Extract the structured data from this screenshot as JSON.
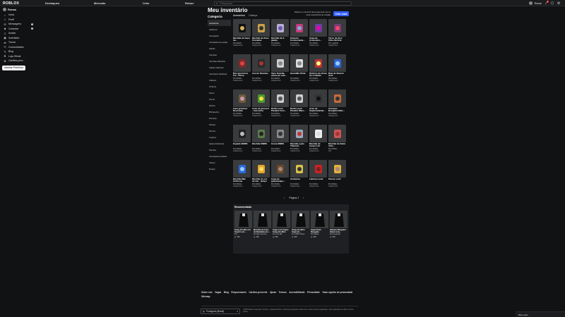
{
  "header": {
    "logo": "ROBLOX",
    "nav": [
      "Destaques",
      "Mercado",
      "Criar",
      "Robux"
    ],
    "search_placeholder": "Pesquisar",
    "username": "Renan",
    "notif_count": "6"
  },
  "sidebar": {
    "user": "Renan",
    "items": [
      {
        "label": "Início",
        "icon": "home-icon"
      },
      {
        "label": "Perfil",
        "icon": "user-icon"
      },
      {
        "label": "Mensagens",
        "icon": "mail-icon",
        "badge": "5"
      },
      {
        "label": "Conectar",
        "icon": "people-icon",
        "badge": "3"
      },
      {
        "label": "Avatar",
        "icon": "avatar-icon"
      },
      {
        "label": "Inventário",
        "icon": "backpack-icon"
      },
      {
        "label": "Trocar",
        "icon": "trade-icon"
      },
      {
        "label": "Comunidades",
        "icon": "group-icon"
      },
      {
        "label": "Blog",
        "icon": "blog-icon"
      },
      {
        "label": "Loja Oficial",
        "icon": "store-icon"
      },
      {
        "label": "Cartões-pres...",
        "icon": "gift-icon"
      }
    ],
    "premium_button": "Assinar Premium"
  },
  "main": {
    "title": "Meu inventário",
    "category_title": "Categoria",
    "tabs": [
      "Acessórios",
      "Cabeça"
    ],
    "hint": "Explore e encontre itens para criar com a nova experiência de criação",
    "create_button": "Criar mais",
    "categories": [
      "Acessórios",
      "Abdômen",
      "Animações",
      "Animações de avatar",
      "Calças",
      "Camisas",
      "Camisas clássicas",
      "Calças clássicas",
      "Camisetas clássicas",
      "Cabelos",
      "Ombros",
      "Faces",
      "Frente",
      "Ofícios",
      "Brinquedos",
      "Pescoço",
      "Passes",
      "Pernas",
      "Lugares",
      "Ações dinâmicas",
      "Pacotes",
      "Animações privadas",
      "Vídeos",
      "Rostos"
    ],
    "items": [
      {
        "name": "Mochila de Caça de...",
        "creator": "Por Roblox",
        "status": "Indisponível"
      },
      {
        "name": "Mochila de Artes Cruzadas",
        "creator": "Por Roblox",
        "status": "Indisponível"
      },
      {
        "name": "Mochila de A jatada",
        "creator": "Por Roblox",
        "status": "Indisponível"
      },
      {
        "name": "Pulseira Cosmonauta...",
        "creator": "Por Roblox",
        "status": "Indisponível"
      },
      {
        "name": "Capa de Assassino...",
        "creator": "Por Roblox",
        "status": "Indisponível"
      },
      {
        "name": "Terno de Alce Ultra-Vertical",
        "creator": "Por Logitech",
        "status": "Indisponível"
      },
      {
        "name": "Nós guerreiros Fur - Pinca",
        "creator": "Por Roblox",
        "status": "Indisponível"
      },
      {
        "name": "Asa do Dracula...",
        "creator": "Por Roblox",
        "status": "Indisponível"
      },
      {
        "name": "Vaso Guarda-chuva de outi...",
        "creator": "Por Roblox",
        "status": "Indisponível"
      },
      {
        "name": "Guardião Prata",
        "creator": "Por Roblox",
        "status": "Indisponível"
      },
      {
        "name": "Ombros de drone de combate",
        "creator": "Por Roblox",
        "status": "Indisponível"
      },
      {
        "name": "Raio de Nuvem Azul",
        "creator": "Por Roblox",
        "status": "Indisponível"
      },
      {
        "name": "Faca grizzinal. Decorada",
        "creator": "Por Roblox",
        "status": "Indisponível"
      },
      {
        "name": "Asas de girassol - Acessório",
        "creator": "Por Roblox",
        "status": "Indisponível"
      },
      {
        "name": "Darth Loom Paradot Fore...",
        "creator": "Por Roblox",
        "status": "Indisponível"
      },
      {
        "name": "Darth Loom Paradot Wars...",
        "creator": "Por Roblox",
        "status": "Indisponível"
      },
      {
        "name": "Asas de Supermaterial...",
        "creator": "Por Roblox",
        "status": "Indisponível"
      },
      {
        "name": "Crianças Bonginia Relic...",
        "creator": "Por Roblox",
        "status": "Indisponível"
      },
      {
        "name": "Espada SINPE",
        "creator": "Por Roblox",
        "status": "Indisponível"
      },
      {
        "name": "Mochila SINPE",
        "creator": "Por Roblox",
        "status": "Indisponível"
      },
      {
        "name": "Cerca SINPE",
        "creator": "Por Roblox",
        "status": "Indisponível"
      },
      {
        "name": "Mochila a jato Titanium",
        "creator": "Por Roblox",
        "status": "Indisponível"
      },
      {
        "name": "Mochila de boneco de neve...",
        "creator": "Por Roblox",
        "status": "Indisponível"
      },
      {
        "name": "Mochila de Salve Vent...",
        "creator": "Por Roblox",
        "status": "100"
      },
      {
        "name": "Mochila Mãe Uniforme",
        "creator": "Por Roblox",
        "status": "Indisponível"
      },
      {
        "name": "Mochila do sol de Hui - tempo",
        "creator": "Por Roblox",
        "status": "Indisponível"
      },
      {
        "name": "Capa de guardanapo...",
        "creator": "Por Roblox",
        "status": "Indisponível"
      },
      {
        "name": "Ambições",
        "creator": "Por Roblox",
        "status": "Indisponível"
      },
      {
        "name": "Lâmina Lunar",
        "creator": "Por Roblox",
        "status": "Indisponível"
      },
      {
        "name": "Pacote estel",
        "creator": "Por Roblox",
        "status": "Indisponível"
      }
    ],
    "pager_label": "Página 2"
  },
  "recommended": {
    "title": "Recomendado",
    "items": [
      {
        "name": "Sung Jin-Woo do Sopol Levi...",
        "creator": "Por ...",
        "price": "100"
      },
      {
        "name": "Mochila de Fera de Dandalna do...",
        "creator": "Por Elfy Aventura",
        "price": "100"
      },
      {
        "name": "Capa com Capuz Sung Jin-Woo",
        "creator": "Por Lord SD...",
        "price": "100"
      },
      {
        "name": "Sung Jin-Woo Capa do...",
        "creator": "Por VPRH Saves",
        "price": "100"
      },
      {
        "name": "Capa Preta Rasgada",
        "creator": "Por Kakkis",
        "price": "100"
      },
      {
        "name": "Sakuna Ninguém Hand com...",
        "creator": "Por Deeper4k",
        "price": "100"
      }
    ]
  },
  "footer": {
    "links": [
      "Sobre nós",
      "Vagas",
      "Blog",
      "Responsáveis",
      "Cartões-presente",
      "Ajuda",
      "Termos",
      "Acessibilidade",
      "Privacidade",
      "Suas opções de privacidade",
      "Sitemap"
    ],
    "language": "Português (Brasil)",
    "copyright": "©2025 Roblox Corporation. Roblox, o logotipo Roblox e Powering Imagination estão entre nossas marcas registradas e não registradas nos EUA e outros países."
  },
  "chat": {
    "label": "Bate-papo"
  }
}
